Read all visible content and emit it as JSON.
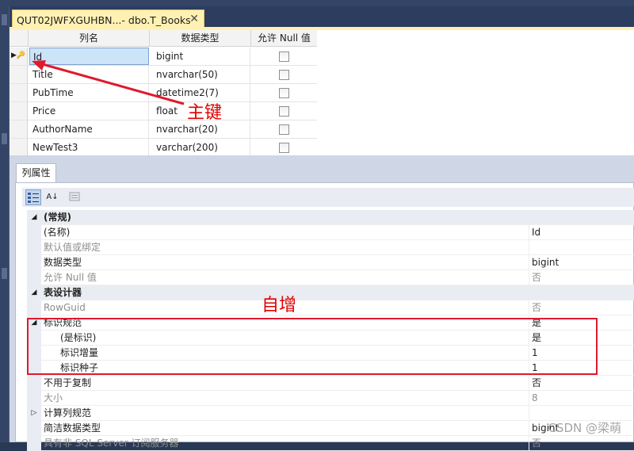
{
  "document_tab": {
    "title": "QUT02JWFXGUHBN...- dbo.T_Books",
    "close": "✕"
  },
  "grid": {
    "headers": {
      "name": "列名",
      "type": "数据类型",
      "allow_null": "允许 Null 值"
    },
    "rows": [
      {
        "name": "Id",
        "type": "bigint",
        "allow_null": false,
        "primary_key": true,
        "selected": true
      },
      {
        "name": "Title",
        "type": "nvarchar(50)",
        "allow_null": false
      },
      {
        "name": "PubTime",
        "type": "datetime2(7)",
        "allow_null": false
      },
      {
        "name": "Price",
        "type": "float",
        "allow_null": false
      },
      {
        "name": "AuthorName",
        "type": "nvarchar(20)",
        "allow_null": false
      },
      {
        "name": "NewTest3",
        "type": "varchar(200)",
        "allow_null": false
      }
    ]
  },
  "annotations": {
    "primary_key_label": "主键",
    "identity_label": "自增",
    "color": "#e00000"
  },
  "properties": {
    "tab_label": "列属性",
    "toolbar": {
      "categorized_icon": "categorized-icon",
      "alphabetical_icon": "alphabetical-icon",
      "pages_icon": "property-pages-icon",
      "alphabetical_label": "A↓"
    },
    "rows": [
      {
        "kind": "cat",
        "expander": "◢",
        "name": "(常规)",
        "value": ""
      },
      {
        "kind": "item",
        "name": "(名称)",
        "value": "Id"
      },
      {
        "kind": "dim",
        "name": "默认值或绑定",
        "value": ""
      },
      {
        "kind": "item",
        "name": "数据类型",
        "value": "bigint"
      },
      {
        "kind": "dim",
        "name": "允许 Null 值",
        "value": "否"
      },
      {
        "kind": "cat",
        "expander": "◢",
        "name": "表设计器",
        "value": ""
      },
      {
        "kind": "dim",
        "name": "RowGuid",
        "value": "否"
      },
      {
        "kind": "item",
        "expander": "◢",
        "name": "标识规范",
        "value": "是"
      },
      {
        "kind": "indent",
        "name": "(是标识)",
        "value": "是"
      },
      {
        "kind": "indent",
        "name": "标识增量",
        "value": "1"
      },
      {
        "kind": "indent",
        "name": "标识种子",
        "value": "1"
      },
      {
        "kind": "item",
        "name": "不用于复制",
        "value": "否"
      },
      {
        "kind": "dim",
        "name": "大小",
        "value": "8"
      },
      {
        "kind": "item",
        "expander": "▷",
        "name": "计算列规范",
        "value": ""
      },
      {
        "kind": "item",
        "name": "简洁数据类型",
        "value": "bigint"
      },
      {
        "kind": "dim",
        "name": "具有非 SQL Server 订阅服务器",
        "value": "否"
      }
    ]
  },
  "watermark": "CSDN @梁萌"
}
